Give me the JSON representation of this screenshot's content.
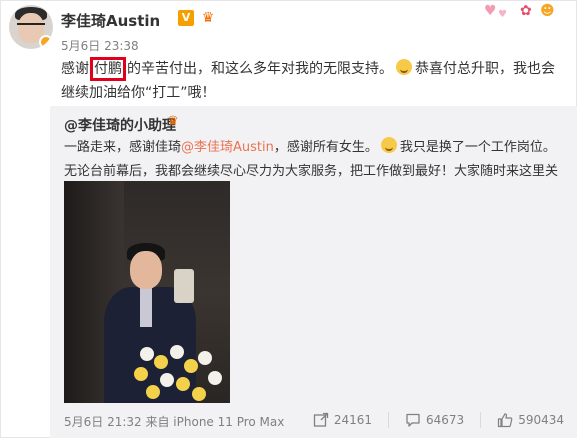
{
  "post": {
    "username": "李佳琦Austin",
    "vip_badge": "V",
    "timestamp": "5月6日 23:38",
    "text_before": "感谢",
    "text_highlight": "付鹏",
    "text_after_1": "的辛苦付出，和这么多年对我的无限支持。",
    "text_after_2": "恭喜付总升职，我也会继续加油给你“打工”哦！"
  },
  "repost": {
    "author": "@李佳琦的小助理",
    "text_1": "一路走来，感谢佳琦",
    "mention": "@李佳琦Austin",
    "text_2": "，感谢所有女生。",
    "text_3": "我只是换了一个工作岗位。无论台前幕后，我都会继续尽心尽力为大家服务，把工作做到最好！大家随时来这里关注我哦～",
    "heart": "❤",
    "meta": "5月6日 21:32 来自 iPhone 11 Pro Max",
    "share_count": "24161",
    "comment_count": "64673",
    "like_count": "590434"
  },
  "icons": {
    "share": "share-icon",
    "comment": "comment-icon",
    "like": "thumbs-up-icon"
  },
  "colors": {
    "highlight_box": "#e0001b",
    "mention": "#eb7350",
    "vip": "#f5a000"
  }
}
